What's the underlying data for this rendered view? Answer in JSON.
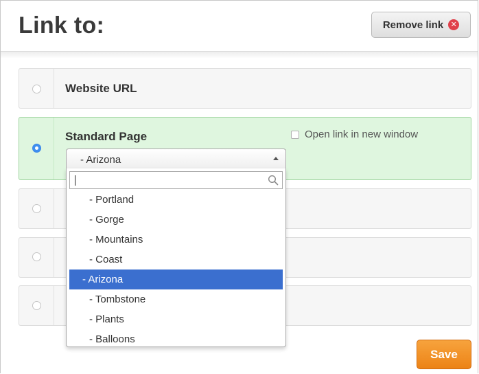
{
  "header": {
    "title": "Link to:",
    "remove_link_label": "Remove link",
    "remove_icon": "close-circle-icon"
  },
  "options": [
    {
      "label": "Website URL",
      "selected": false
    },
    {
      "label": "Standard Page",
      "selected": true
    },
    {
      "label": "",
      "selected": false
    },
    {
      "label": "",
      "selected": false
    },
    {
      "label": "",
      "selected": false
    }
  ],
  "new_window_checkbox": {
    "label": "Open link in new window",
    "checked": false
  },
  "page_select": {
    "selected_value": "- Arizona",
    "search_value": "",
    "search_icon": "search-icon",
    "items": [
      {
        "label": "  - Portland",
        "highlighted": false
      },
      {
        "label": "  - Gorge",
        "highlighted": false
      },
      {
        "label": "  - Mountains",
        "highlighted": false
      },
      {
        "label": "  - Coast",
        "highlighted": false
      },
      {
        "label": "- Arizona",
        "highlighted": true
      },
      {
        "label": "  - Tombstone",
        "highlighted": false
      },
      {
        "label": "  - Plants",
        "highlighted": false
      },
      {
        "label": "  - Balloons",
        "highlighted": false
      }
    ]
  },
  "footer": {
    "save_label": "Save"
  },
  "colors": {
    "selected_row_bg": "#dff6df",
    "highlight_bg": "#3b6fcf",
    "save_button": "#ec8316",
    "radio_checked": "#3f8ff0"
  }
}
